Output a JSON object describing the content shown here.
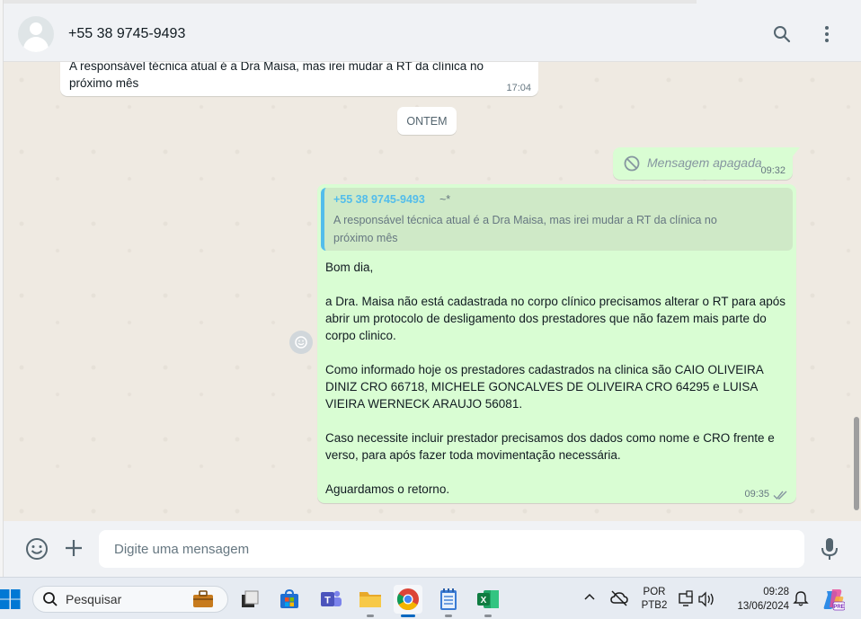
{
  "header": {
    "contact_name": "+55 38 9745-9493",
    "icons": [
      "search-icon",
      "menu-dots-icon"
    ]
  },
  "messages": {
    "top_incoming": {
      "text_lines": [
        "A responsável técnica atual é a Dra Maisa, mas irei mudar a RT da clínica no",
        "próximo mês"
      ],
      "time": "17:04"
    },
    "date_divider": "ONTEM",
    "deleted": {
      "text": "Mensagem apagada",
      "time": "09:32"
    },
    "reply": {
      "quote_author": "+55 38 9745-9493",
      "quote_pushname": "~*",
      "quote_text": "A responsável técnica atual é a Dra Maisa, mas irei mudar a RT da clínica no próximo mês",
      "paragraphs": [
        "Bom dia,",
        "",
        "a Dra. Maisa não está cadastrada no corpo clínico precisamos alterar o RT para após abrir um protocolo de desligamento dos prestadores que não fazem mais parte do corpo clinico.",
        "",
        "Como informado hoje os prestadores cadastrados na clinica são CAIO OLIVEIRA DINIZ CRO 66718, MICHELE GONCALVES DE OLIVEIRA CRO 64295 e LUISA VIEIRA WERNECK ARAUJO 56081.",
        "",
        "Caso necessite incluir prestador precisamos dos dados como nome e CRO frente e verso, para após fazer toda movimentação necessária.",
        "",
        "Aguardamos o retorno."
      ],
      "time": "09:35",
      "status": "double-check-icon"
    }
  },
  "composer": {
    "placeholder": "Digite uma mensagem"
  },
  "taskbar": {
    "search_label": "Pesquisar",
    "apps": [
      "file-explorer-tile-icon",
      "store-icon",
      "teams-icon",
      "folder-icon",
      "chrome-icon",
      "notepad-icon",
      "excel-icon"
    ],
    "lang_line1": "POR",
    "lang_line2": "PTB2",
    "time": "09:28",
    "date": "13/06/2024"
  },
  "colors": {
    "outgoing_bubble": "#d9fdd3",
    "quote_accent": "#53bdeb",
    "chat_bg": "#efeae2",
    "header_bg": "#f0f2f5"
  }
}
